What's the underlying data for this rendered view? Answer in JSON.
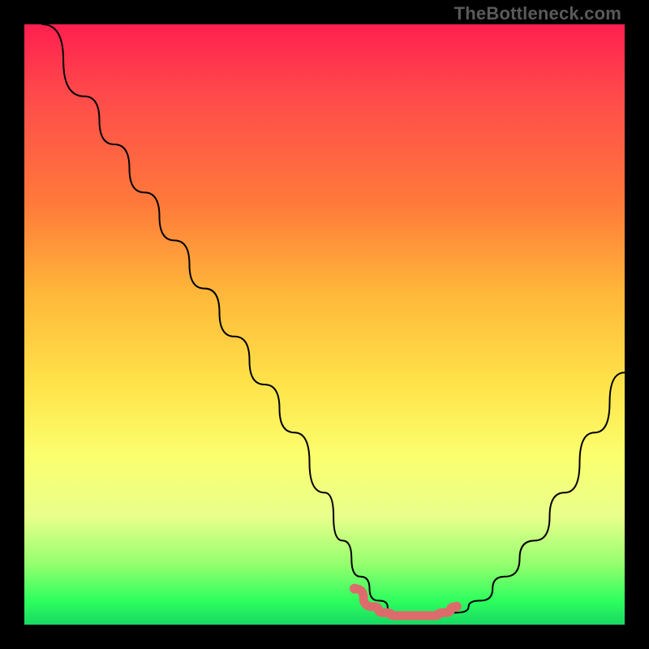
{
  "watermark": "TheBottleneck.com",
  "chart_data": {
    "type": "line",
    "title": "",
    "xlabel": "",
    "ylabel": "",
    "xlim": [
      0,
      100
    ],
    "ylim": [
      0,
      100
    ],
    "series": [
      {
        "name": "bottleneck-curve",
        "color": "#000000",
        "x": [
          3,
          10,
          15,
          20,
          25,
          30,
          35,
          40,
          45,
          50,
          53,
          56,
          59,
          62,
          65,
          68,
          72,
          76,
          80,
          85,
          90,
          95,
          100
        ],
        "y": [
          100,
          88,
          80,
          72,
          64,
          56,
          48,
          40,
          32,
          22,
          14,
          8,
          4,
          2,
          1.5,
          1.5,
          2,
          4,
          8,
          14,
          22,
          32,
          42
        ]
      },
      {
        "name": "optimal-range",
        "color": "#de6b6b",
        "x": [
          55,
          58,
          60,
          62,
          65,
          68,
          70,
          72
        ],
        "y": [
          6,
          3,
          2,
          1.5,
          1.5,
          1.5,
          2,
          3
        ]
      }
    ],
    "markers": [
      {
        "name": "optimal-start",
        "x": 55,
        "y": 6,
        "color": "#de6b6b"
      },
      {
        "name": "optimal-end",
        "x": 72,
        "y": 3,
        "color": "#de6b6b"
      }
    ],
    "gradient_stops": [
      {
        "pos": 0,
        "color": "#ff1f4f"
      },
      {
        "pos": 12,
        "color": "#ff4b4b"
      },
      {
        "pos": 30,
        "color": "#ff7a3a"
      },
      {
        "pos": 45,
        "color": "#ffb83a"
      },
      {
        "pos": 60,
        "color": "#ffe34a"
      },
      {
        "pos": 72,
        "color": "#fbff6e"
      },
      {
        "pos": 82,
        "color": "#e8ff8c"
      },
      {
        "pos": 90,
        "color": "#94ff6e"
      },
      {
        "pos": 96,
        "color": "#2eff5e"
      },
      {
        "pos": 100,
        "color": "#18d862"
      }
    ]
  }
}
